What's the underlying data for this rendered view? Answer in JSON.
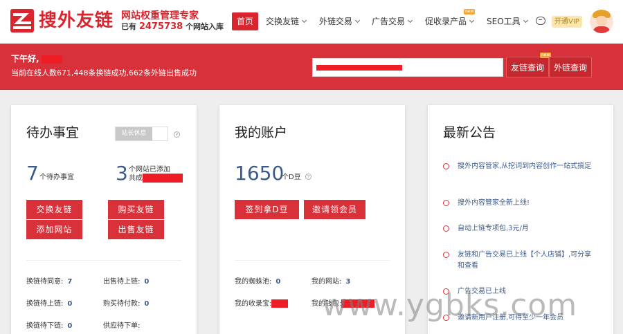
{
  "brand": {
    "name": "搜外友链",
    "slogan": "网站权重管理专家",
    "site_count_prefix": "已有",
    "site_count": "2475738",
    "site_count_suffix": "个网站入库"
  },
  "nav": {
    "items": [
      {
        "label": "首页",
        "active": true,
        "dropdown": false
      },
      {
        "label": "交换友链",
        "active": false,
        "dropdown": true
      },
      {
        "label": "外链交易",
        "active": false,
        "dropdown": true
      },
      {
        "label": "广告交易",
        "active": false,
        "dropdown": true
      },
      {
        "label": "促收录产品",
        "active": false,
        "dropdown": true,
        "badge": "new"
      },
      {
        "label": "SEO工具",
        "active": false,
        "dropdown": true
      }
    ],
    "vip_label": "开通VIP"
  },
  "banner": {
    "greeting": "下午好,",
    "online_status": "当前在线人数671,448条换链成功,662条外链出售成功",
    "lookup_buttons": [
      {
        "label": "友链查询",
        "badge": "new"
      },
      {
        "label": "外链查询"
      }
    ]
  },
  "todo_card": {
    "title": "待办事宜",
    "toggle_label": "站长休息",
    "pending_count": "7",
    "pending_label": "个待办事宜",
    "sites_count": "3",
    "sites_label_line1": "个网站已添加",
    "sites_label_line2": "共成",
    "buttons": [
      "交换友链",
      "购买友链",
      "添加网站",
      "出售友链"
    ],
    "stats": [
      {
        "label": "换链待同意:",
        "value": "7"
      },
      {
        "label": "出售待上链:",
        "value": "0"
      },
      {
        "label": "换链待上链:",
        "value": "0"
      },
      {
        "label": "购买待付款:",
        "value": "0"
      },
      {
        "label": "换链待下链:",
        "value": "0"
      },
      {
        "label": "供应待下单:",
        "value": ""
      }
    ]
  },
  "account_card": {
    "title": "我的账户",
    "balance": "1650",
    "balance_unit": "个D豆",
    "buttons": [
      "签到拿D豆",
      "邀请领会员"
    ],
    "stats": [
      {
        "label": "我的蜘蛛池:",
        "value": "0"
      },
      {
        "label": "我的网站:",
        "value": "3"
      },
      {
        "label": "我的收录宝:",
        "value": ""
      },
      {
        "label": "我的钱包:",
        "value": ""
      }
    ]
  },
  "notice_card": {
    "title": "最新公告",
    "items": [
      "搜外内容管家,从挖词到内容创作一站式搞定",
      "搜外内容管家全新上线!",
      "自动上链专项包,3元/月",
      "友链和广告交易已上线【个人店铺】,可分享和查看",
      "广告交易已上线",
      "邀请新用户注册,可得至少一年会员"
    ]
  },
  "watermark": "www.ygbks.com",
  "colors": {
    "brand_red": "#d9252d",
    "banner_red": "#d9313a",
    "link_blue": "#3a5a8c"
  }
}
